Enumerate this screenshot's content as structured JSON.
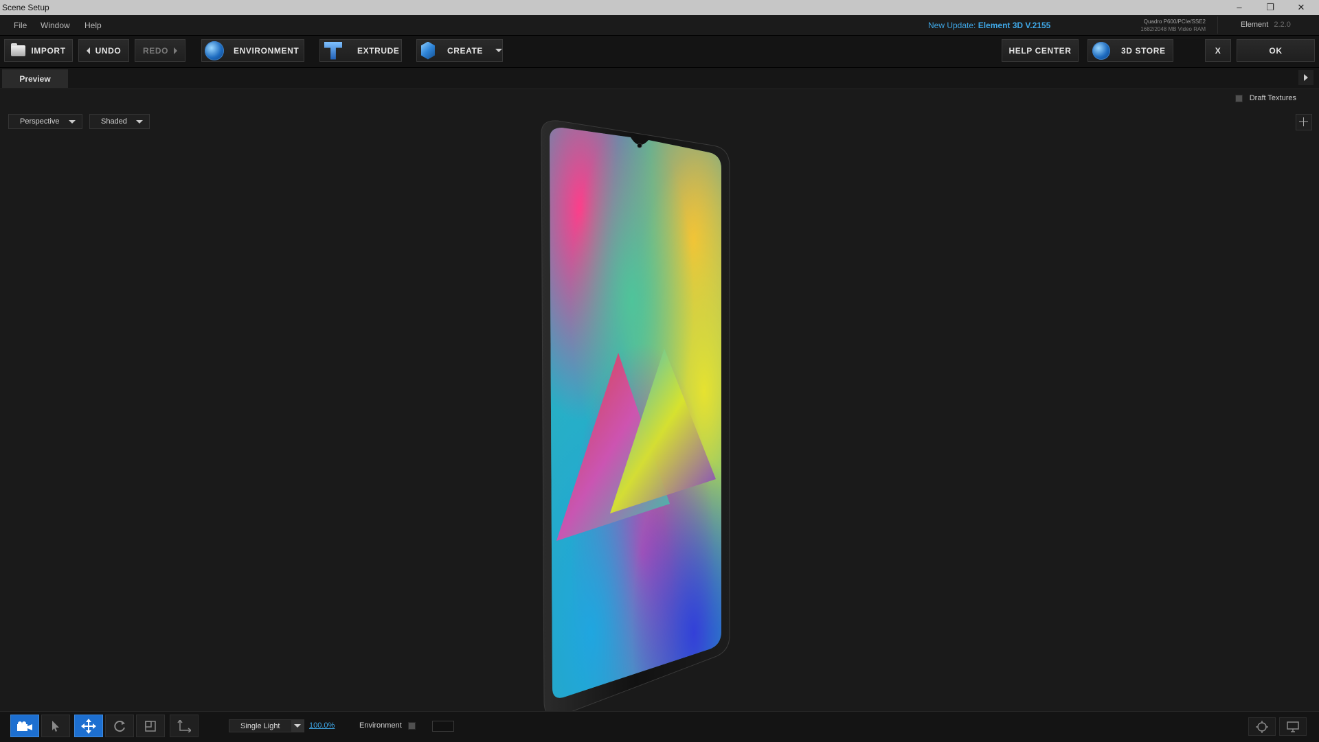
{
  "window": {
    "title": "Scene Setup",
    "controls": [
      "–",
      "❐",
      "✕"
    ]
  },
  "menu": {
    "items": [
      "File",
      "Window",
      "Help"
    ],
    "update_prefix": "New Update:",
    "update_version": "Element 3D V.2155",
    "gpu_name": "Quadro P600/PCIe/SSE2",
    "gpu_ram": "1682/2048 MB Video RAM",
    "plugin_name": "Element",
    "plugin_version": "2.2.0"
  },
  "toolbar": {
    "import": "IMPORT",
    "undo": "UNDO",
    "redo": "REDO",
    "environment": "ENVIRONMENT",
    "extrude": "EXTRUDE",
    "create": "CREATE",
    "help_center": "HELP CENTER",
    "store": "3D STORE",
    "close": "X",
    "ok": "OK"
  },
  "tabs": {
    "preview": "Preview"
  },
  "viewport": {
    "draft_textures": "Draft Textures",
    "view_mode": "Perspective",
    "shading_mode": "Shaded"
  },
  "bottom": {
    "light_mode": "Single Light",
    "light_percent": "100.0%",
    "environment_label": "Environment"
  },
  "colors": {
    "accent": "#1d6fd0",
    "link": "#3fa8e8",
    "background": "#1a1a1a"
  }
}
